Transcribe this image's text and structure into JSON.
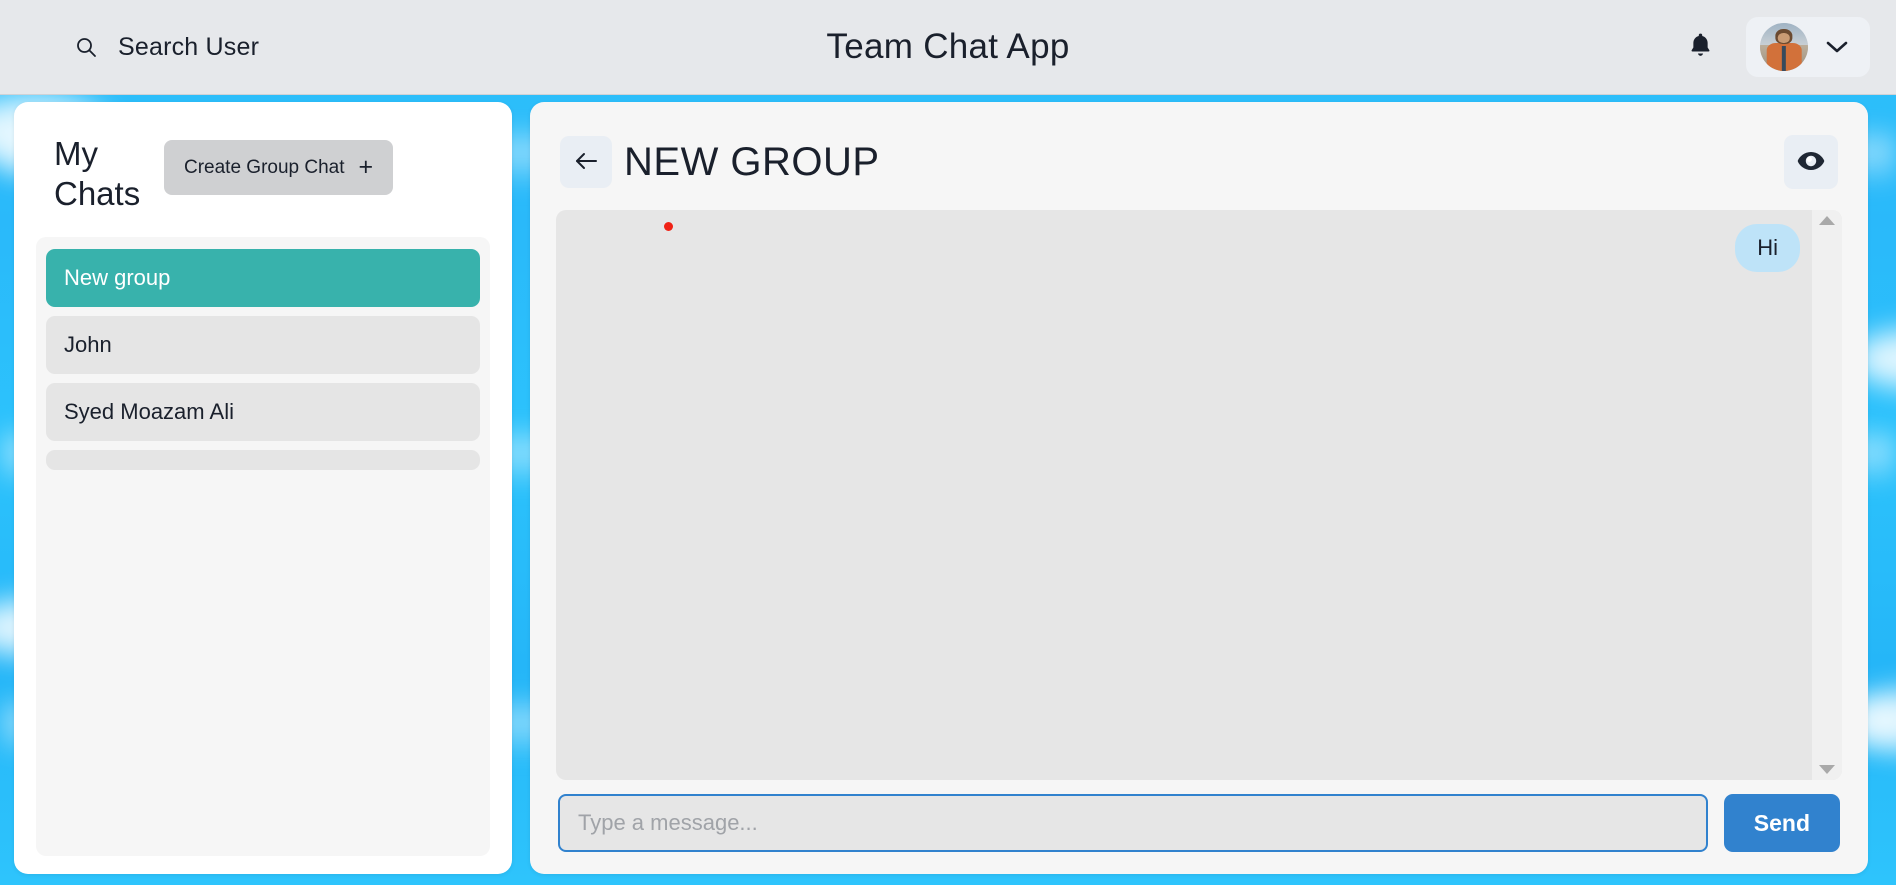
{
  "topbar": {
    "search_label": "Search User",
    "search_icon": "search-icon",
    "app_title": "Team Chat App",
    "bell_icon": "bell-icon",
    "avatar_icon": "user-avatar",
    "chevron_icon": "chevron-down-icon"
  },
  "sidebar": {
    "title": "My Chats",
    "create_group_label": "Create Group Chat",
    "plus_icon": "+",
    "items": [
      {
        "label": "New group",
        "active": true
      },
      {
        "label": "John",
        "active": false
      },
      {
        "label": "Syed Moazam Ali",
        "active": false
      },
      {
        "label": "",
        "active": false
      }
    ]
  },
  "chat": {
    "back_icon": "arrow-left-icon",
    "title": "NEW GROUP",
    "eye_icon": "eye-icon",
    "typing_indicator": "typing-dot",
    "messages": [
      {
        "text": "Hi",
        "side": "right"
      }
    ],
    "scroll_up_icon": "scroll-up-arrow",
    "scroll_down_icon": "scroll-down-arrow",
    "input_placeholder": "Type a message...",
    "input_value": "",
    "send_label": "Send"
  },
  "colors": {
    "backdrop": "#2cc3fc",
    "topbar": "#e6e8eb",
    "active_chat": "#38b2ac",
    "send_button": "#3182ce",
    "bubble": "#bee3f8",
    "typing_dot": "#f02216"
  }
}
